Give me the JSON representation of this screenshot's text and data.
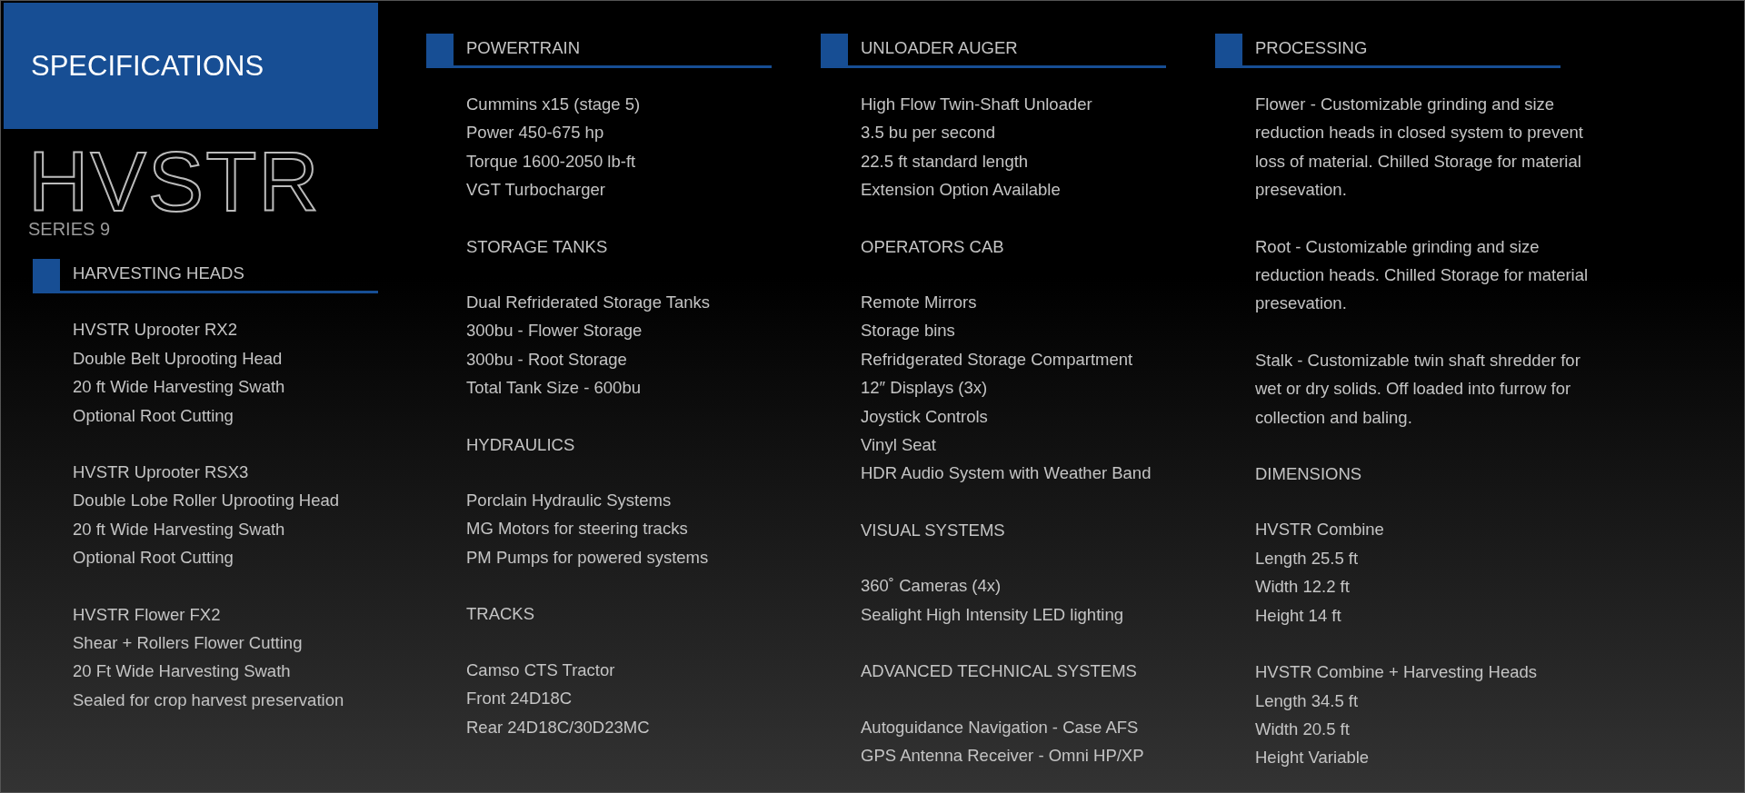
{
  "title": "SPECIFICATIONS",
  "logo": {
    "name": "HVSTR",
    "series": "SERIES 9"
  },
  "columns": [
    {
      "sections": [
        {
          "kind": "banner",
          "heading": "HARVESTING HEADS",
          "groups": [
            [
              "HVSTR Uprooter RX2",
              "Double Belt Uprooting Head",
              "20 ft Wide Harvesting Swath",
              "Optional Root Cutting"
            ],
            [
              "HVSTR Uprooter RSX3",
              "Double Lobe Roller Uprooting Head",
              "20 ft Wide Harvesting Swath",
              "Optional Root Cutting"
            ],
            [
              "HVSTR Flower FX2",
              "Shear + Rollers Flower Cutting",
              "20 Ft Wide Harvesting Swath",
              "Sealed for crop harvest preservation"
            ]
          ]
        }
      ]
    },
    {
      "sections": [
        {
          "kind": "banner",
          "heading": "POWERTRAIN",
          "groups": [
            [
              "Cummins x15 (stage 5)",
              "Power 450-675 hp",
              "Torque 1600-2050 lb-ft",
              "VGT Turbocharger"
            ]
          ]
        },
        {
          "kind": "plain",
          "heading": "STORAGE TANKS",
          "groups": [
            [
              "Dual Refriderated Storage Tanks",
              "300bu - Flower Storage",
              "300bu - Root Storage",
              "Total Tank Size - 600bu"
            ]
          ]
        },
        {
          "kind": "plain",
          "heading": "HYDRAULICS",
          "groups": [
            [
              "Porclain Hydraulic Systems",
              "MG Motors for steering tracks",
              "PM Pumps for powered systems"
            ]
          ]
        },
        {
          "kind": "plain",
          "heading": "TRACKS",
          "groups": [
            [
              "Camso CTS Tractor",
              "Front 24D18C",
              "Rear 24D18C/30D23MC"
            ]
          ]
        }
      ]
    },
    {
      "sections": [
        {
          "kind": "banner",
          "heading": "UNLOADER AUGER",
          "groups": [
            [
              "High Flow Twin-Shaft Unloader",
              "3.5 bu per second",
              "22.5 ft  standard length",
              "Extension Option Available"
            ]
          ]
        },
        {
          "kind": "plain",
          "heading": "OPERATORS CAB",
          "groups": [
            [
              "Remote Mirrors",
              "Storage bins",
              "Refridgerated Storage Compartment",
              "12″ Displays (3x)",
              "Joystick Controls",
              "Vinyl Seat",
              "HDR Audio System with Weather Band"
            ]
          ]
        },
        {
          "kind": "plain",
          "heading": "VISUAL SYSTEMS",
          "groups": [
            [
              "360˚ Cameras (4x)",
              "Sealight High Intensity LED lighting"
            ]
          ]
        },
        {
          "kind": "plain",
          "heading": "ADVANCED TECHNICAL SYSTEMS",
          "groups": [
            [
              "Autoguidance Navigation - Case AFS",
              "GPS Antenna Receiver - Omni HP/XP"
            ]
          ]
        }
      ]
    },
    {
      "sections": [
        {
          "kind": "banner",
          "heading": "PROCESSING",
          "groups": [
            [
              "Flower - Customizable grinding and size reduction heads in closed system to prevent loss of material.  Chilled Storage for material presevation."
            ],
            [
              "Root - Customizable grinding and size reduction heads.  Chilled Storage for material presevation."
            ],
            [
              "Stalk - Customizable twin shaft shredder for wet or dry solids.  Off loaded into furrow for collection and baling."
            ]
          ]
        },
        {
          "kind": "plain",
          "heading": "DIMENSIONS",
          "groups": [
            [
              "HVSTR Combine",
              "Length 25.5 ft",
              "Width 12.2 ft",
              "Height 14 ft"
            ],
            [
              "HVSTR Combine + Harvesting Heads",
              "Length 34.5 ft",
              "Width 20.5 ft",
              "Height Variable"
            ]
          ]
        }
      ]
    }
  ]
}
